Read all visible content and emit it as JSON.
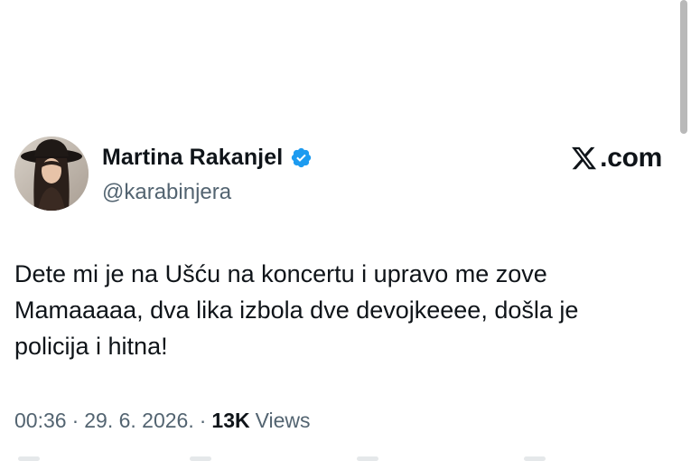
{
  "author": {
    "name": "Martina Rakanjel",
    "handle": "@karabinjera",
    "verified": true
  },
  "brand": {
    "text": ".com",
    "icon": "x-logo-icon"
  },
  "tweet": {
    "text": "Dete mi je na Ušću na koncertu i upravo me zove\nMamaaaaa, dva lika izbola dve devojkeeee, došla je\npolicija i hitna!"
  },
  "meta": {
    "time": "00:36",
    "separator": "·",
    "date": "29. 6. 2026.",
    "views_count": "13K",
    "views_label": "Views"
  },
  "colors": {
    "text": "#0f1419",
    "secondary": "#536471",
    "verified": "#1d9bf0",
    "background": "#ffffff"
  }
}
